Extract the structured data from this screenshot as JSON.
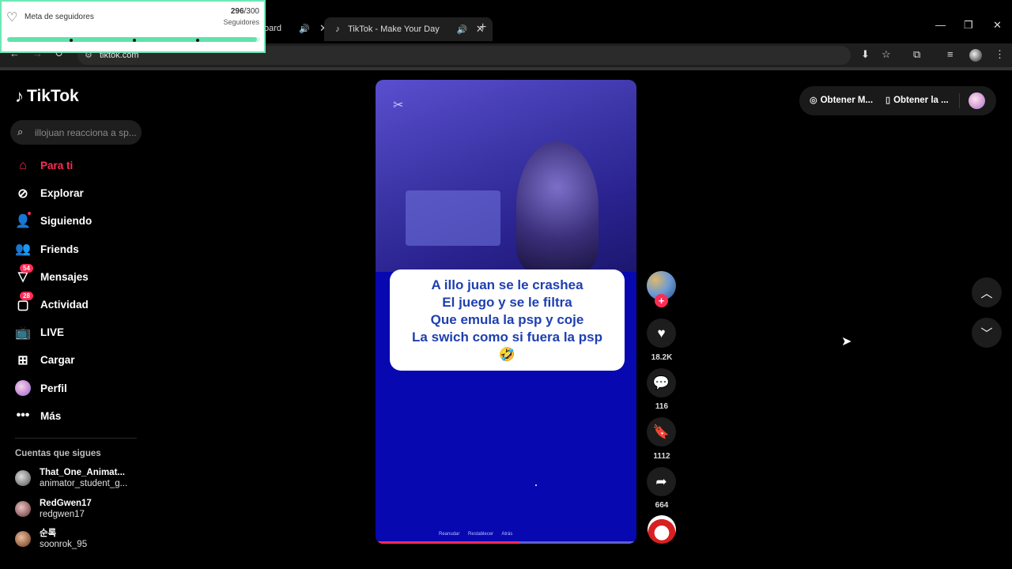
{
  "browser": {
    "partial_tab_label": "oard",
    "active_tab_title": "TikTok - Make Your Day",
    "url": "tiktok.com"
  },
  "goal_widget": {
    "title": "Meta de seguidores",
    "count_current": "296",
    "count_total": "/300",
    "subtitle": "Seguidores",
    "progress_fraction": 0.987
  },
  "tiktok": {
    "logo_text": "TikTok",
    "search_placeholder": "illojuan reacciona a sp...",
    "menu": [
      {
        "label": "Para ti",
        "icon": "home-icon"
      },
      {
        "label": "Explorar",
        "icon": "compass-icon"
      },
      {
        "label": "Siguiendo",
        "icon": "following-icon"
      },
      {
        "label": "Friends",
        "icon": "friends-icon"
      },
      {
        "label": "Mensajes",
        "icon": "inbox-icon",
        "badge": "54"
      },
      {
        "label": "Actividad",
        "icon": "activity-icon",
        "badge": "28"
      },
      {
        "label": "LIVE",
        "icon": "live-tv-icon"
      },
      {
        "label": "Cargar",
        "icon": "upload-icon"
      },
      {
        "label": "Perfil",
        "icon": "profile-avatar"
      },
      {
        "label": "Más",
        "icon": "more-icon"
      }
    ],
    "following_title": "Cuentas que sigues",
    "following": [
      {
        "name": "That_One_Animat...",
        "handle": "animator_student_g..."
      },
      {
        "name": "RedGwen17",
        "handle": "redgwen17"
      },
      {
        "name": "순록",
        "handle": "soonrok_95"
      }
    ]
  },
  "video": {
    "caption_lines": [
      "A illo juan se le crashea",
      "El juego y se le filtra",
      "Que emula la psp y coje",
      "La swich como si fuera la psp",
      "🤣"
    ],
    "mini_controls": [
      "Reanudar",
      "Restablecer",
      "Atrás"
    ],
    "progress_fraction": 0.55
  },
  "actions": {
    "likes": "18.2K",
    "comments": "116",
    "saves": "1112",
    "shares": "664"
  },
  "top_right": {
    "pill1": "Obtener M...",
    "pill2": "Obtener la ..."
  }
}
